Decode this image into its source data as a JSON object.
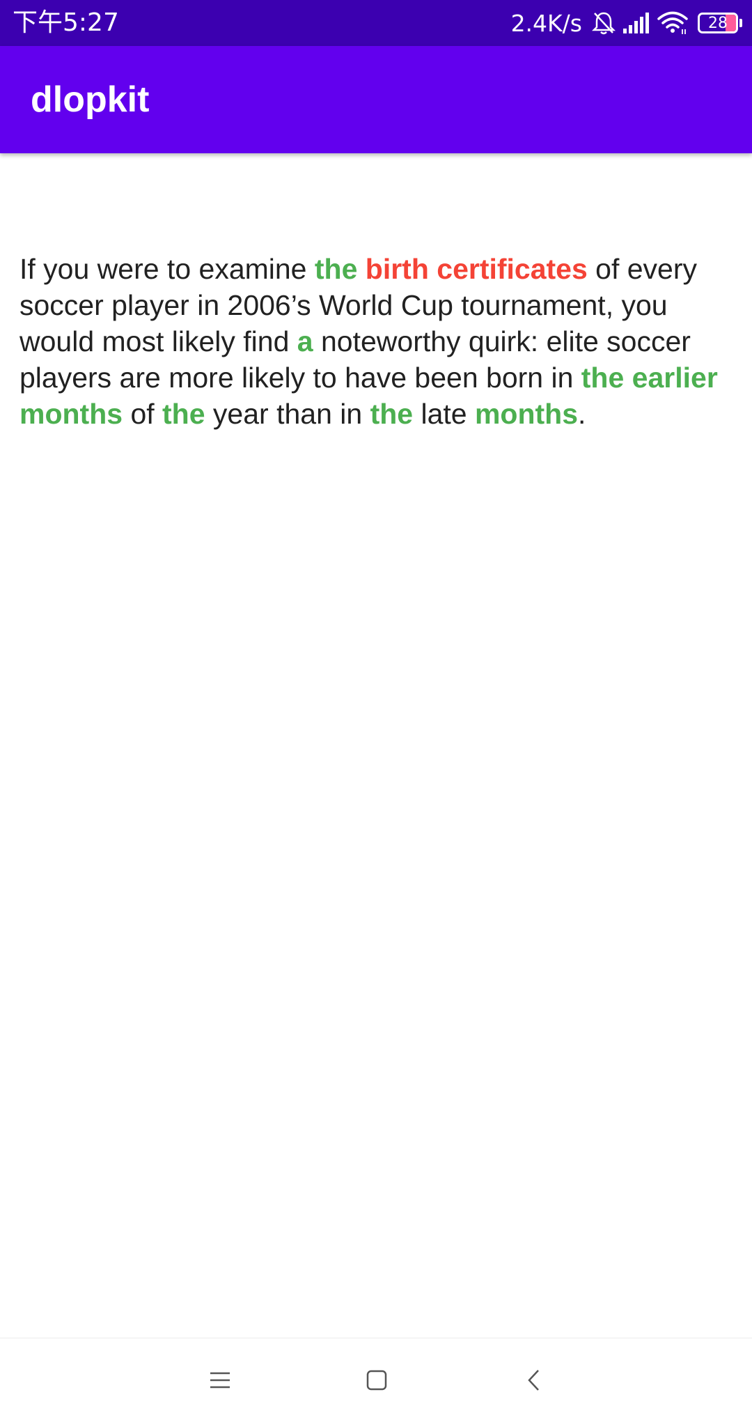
{
  "status_bar": {
    "time": "下午5:27",
    "net_speed": "2.4K/s",
    "battery_level": "28",
    "icons": [
      "bell-off-icon",
      "signal-icon",
      "wifi-icon",
      "battery-icon"
    ]
  },
  "app_bar": {
    "title": "dlopkit"
  },
  "content": {
    "segments": [
      {
        "text": "If you were to examine ",
        "style": "plain"
      },
      {
        "text": "the",
        "style": "green"
      },
      {
        "text": " ",
        "style": "plain"
      },
      {
        "text": "birth certificates",
        "style": "red"
      },
      {
        "text": " of every soccer player in 2006’s World Cup tournament, you would most likely find ",
        "style": "plain"
      },
      {
        "text": "a",
        "style": "green"
      },
      {
        "text": " noteworthy quirk: elite soccer players are more likely to have been born in ",
        "style": "plain"
      },
      {
        "text": "the earlier months",
        "style": "green"
      },
      {
        "text": " of ",
        "style": "plain"
      },
      {
        "text": "the",
        "style": "green"
      },
      {
        "text": " year than in ",
        "style": "plain"
      },
      {
        "text": "the",
        "style": "green"
      },
      {
        "text": " late ",
        "style": "plain"
      },
      {
        "text": "months",
        "style": "green"
      },
      {
        "text": ".",
        "style": "plain"
      }
    ]
  },
  "colors": {
    "status_bar": "#3c00b0",
    "app_bar": "#6200ee",
    "highlight_green": "#4caf50",
    "highlight_red": "#f44336",
    "body_text": "#212121"
  },
  "nav_bar": {
    "icons": [
      "menu-icon",
      "home-icon",
      "back-icon"
    ]
  }
}
